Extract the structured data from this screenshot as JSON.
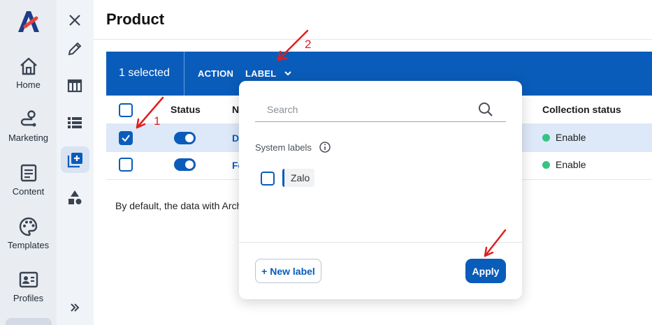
{
  "nav": {
    "items": [
      {
        "label": "Home",
        "icon": "home-icon"
      },
      {
        "label": "Marketing",
        "icon": "route-icon"
      },
      {
        "label": "Content",
        "icon": "document-icon"
      },
      {
        "label": "Templates",
        "icon": "palette-icon"
      },
      {
        "label": "Profiles",
        "icon": "id-card-icon"
      }
    ]
  },
  "page": {
    "title": "Product"
  },
  "actionbar": {
    "selected": "1 selected",
    "action": "ACTION",
    "label": "LABEL"
  },
  "table": {
    "headers": {
      "status": "Status",
      "name": "N",
      "collection_status": "Collection status"
    },
    "rows": [
      {
        "checked": true,
        "status_on": true,
        "name": "Di",
        "collection_status": "Enable"
      },
      {
        "checked": false,
        "status_on": true,
        "name": "Fe",
        "collection_status": "Enable"
      }
    ]
  },
  "note": "By default, the data with Arch",
  "popover": {
    "search_placeholder": "Search",
    "system_labels": "System labels",
    "labels": [
      "Zalo"
    ],
    "new_label": "+ New label",
    "apply": "Apply"
  },
  "annotations": {
    "one": "1",
    "two": "2"
  },
  "colors": {
    "primary": "#0a5cba",
    "enable_dot": "#35c483",
    "annotation": "#e01e1e"
  }
}
